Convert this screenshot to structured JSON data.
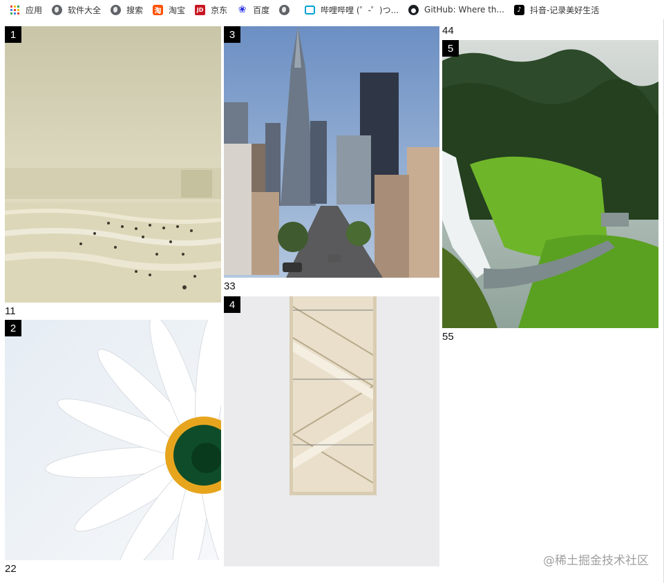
{
  "bookmarks": [
    {
      "label": "应用",
      "icon": "apps-grid-icon"
    },
    {
      "label": "软件大全",
      "icon": "globe-icon"
    },
    {
      "label": "搜索",
      "icon": "globe-icon"
    },
    {
      "label": "淘宝",
      "icon": "taobao-icon"
    },
    {
      "label": "京东",
      "icon": "jd-icon"
    },
    {
      "label": "百度",
      "icon": "baidu-paw-icon"
    },
    {
      "label": "",
      "icon": "globe-icon"
    },
    {
      "label": "哔哩哔哩 (゜-゜)つ...",
      "icon": "bilibili-tv-icon"
    },
    {
      "label": "GitHub: Where th...",
      "icon": "github-octocat-icon"
    },
    {
      "label": "抖音-记录美好生活",
      "icon": "tiktok-icon"
    }
  ],
  "cards": [
    {
      "number": "1",
      "caption": "11",
      "subject": "beach"
    },
    {
      "number": "2",
      "caption": "22",
      "subject": "daisy"
    },
    {
      "number": "3",
      "caption": "33",
      "subject": "city-street"
    },
    {
      "number": "4",
      "caption": "44",
      "subject": "staircase"
    },
    {
      "number": "5",
      "caption": "55",
      "subject": "waterfall"
    }
  ],
  "watermark": "@稀土掘金技术社区"
}
